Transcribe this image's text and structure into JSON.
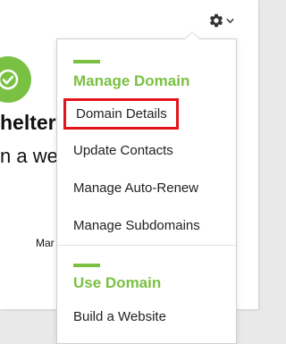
{
  "page": {
    "heading": "helter",
    "subtext": "n a web",
    "small_text": "Mar"
  },
  "header": {
    "settings_icon": "gear-icon",
    "dropdown_icon": "chevron-down-icon"
  },
  "menu": {
    "sections": [
      {
        "title": "Manage Domain",
        "items": [
          {
            "label": "Domain Details",
            "highlighted": true
          },
          {
            "label": "Update Contacts"
          },
          {
            "label": "Manage Auto-Renew"
          },
          {
            "label": "Manage Subdomains"
          }
        ]
      },
      {
        "title": "Use Domain",
        "items": [
          {
            "label": "Build a Website"
          }
        ]
      }
    ]
  },
  "colors": {
    "accent": "#7ac143",
    "highlight_border": "#e3141c",
    "text": "#222222"
  },
  "icons": {
    "status": "checkmark-circle-icon"
  }
}
